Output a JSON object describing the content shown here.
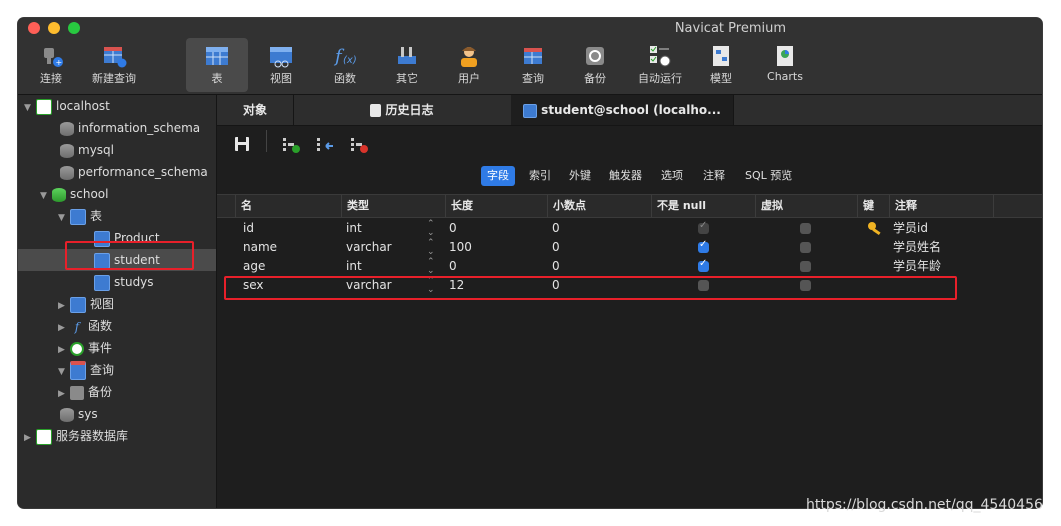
{
  "window": {
    "title": "Navicat Premium"
  },
  "colors": {
    "accent": "#2f7be6",
    "highlight": "#e8202a",
    "key": "#f0b323"
  },
  "toolbar": {
    "items": [
      {
        "label": "连接",
        "icon": "plug-icon"
      },
      {
        "label": "新建查询",
        "icon": "new-query-icon"
      },
      {
        "label": "表",
        "icon": "table-icon"
      },
      {
        "label": "视图",
        "icon": "view-icon"
      },
      {
        "label": "函数",
        "icon": "function-icon"
      },
      {
        "label": "其它",
        "icon": "tools-icon"
      },
      {
        "label": "用户",
        "icon": "user-icon"
      },
      {
        "label": "查询",
        "icon": "query-icon"
      },
      {
        "label": "备份",
        "icon": "backup-icon"
      },
      {
        "label": "自动运行",
        "icon": "automation-icon"
      },
      {
        "label": "模型",
        "icon": "model-icon"
      },
      {
        "label": "Charts",
        "icon": "charts-icon"
      }
    ]
  },
  "sidebar": {
    "connection": "localhost",
    "databases": {
      "information_schema": "information_schema",
      "mysql": "mysql",
      "performance_schema": "performance_schema",
      "school": "school",
      "sys": "sys"
    },
    "school_children": {
      "tables": "表",
      "views": "视图",
      "functions": "函数",
      "events": "事件",
      "queries": "查询",
      "backups": "备份"
    },
    "tables": [
      "Product",
      "student",
      "studys"
    ],
    "server_db": "服务器数据库"
  },
  "tabs": [
    {
      "label": "对象"
    },
    {
      "label": "历史日志"
    },
    {
      "label": "student@school (localho..."
    }
  ],
  "field_tabs": [
    "字段",
    "索引",
    "外键",
    "触发器",
    "选项",
    "注释",
    "SQL 预览"
  ],
  "columns": [
    "名",
    "类型",
    "长度",
    "小数点",
    "不是 null",
    "虚拟",
    "键",
    "注释"
  ],
  "rows": [
    {
      "name": "id",
      "type": "int",
      "length": "0",
      "decimals": "0",
      "not_null": true,
      "virtual": false,
      "key": true,
      "comment": "学员id"
    },
    {
      "name": "name",
      "type": "varchar",
      "length": "100",
      "decimals": "0",
      "not_null": true,
      "virtual": false,
      "key": false,
      "comment": "学员姓名"
    },
    {
      "name": "age",
      "type": "int",
      "length": "0",
      "decimals": "0",
      "not_null": true,
      "virtual": false,
      "key": false,
      "comment": "学员年龄"
    },
    {
      "name": "sex",
      "type": "varchar",
      "length": "12",
      "decimals": "0",
      "not_null": false,
      "virtual": false,
      "key": false,
      "comment": ""
    }
  ],
  "watermark": "https://blog.csdn.net/qq_4540456"
}
